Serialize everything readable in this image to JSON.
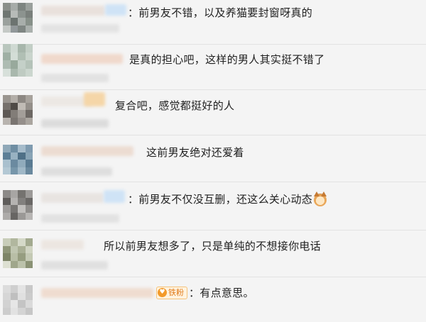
{
  "comments": [
    {
      "text": "：前男友不错，以及养猫要封窗呀真的"
    },
    {
      "text": "是真的担心吧，这样的男人其实挺不错了"
    },
    {
      "text": "复合吧，感觉都挺好的人"
    },
    {
      "text": "这前男友绝对还爱着"
    },
    {
      "text": "：前男友不仅没互删，还这么关心动态",
      "emoji": "cat-face-emoji-icon"
    },
    {
      "text": "所以前男友想多了，只是单纯的不想接你电话"
    },
    {
      "text": "：有点意思。",
      "badge": "铁粉"
    }
  ],
  "colors": {
    "background": "#f4f4f4",
    "divider": "#e2e2e2",
    "text": "#1f1f1f",
    "badge": "#f39a2a"
  }
}
